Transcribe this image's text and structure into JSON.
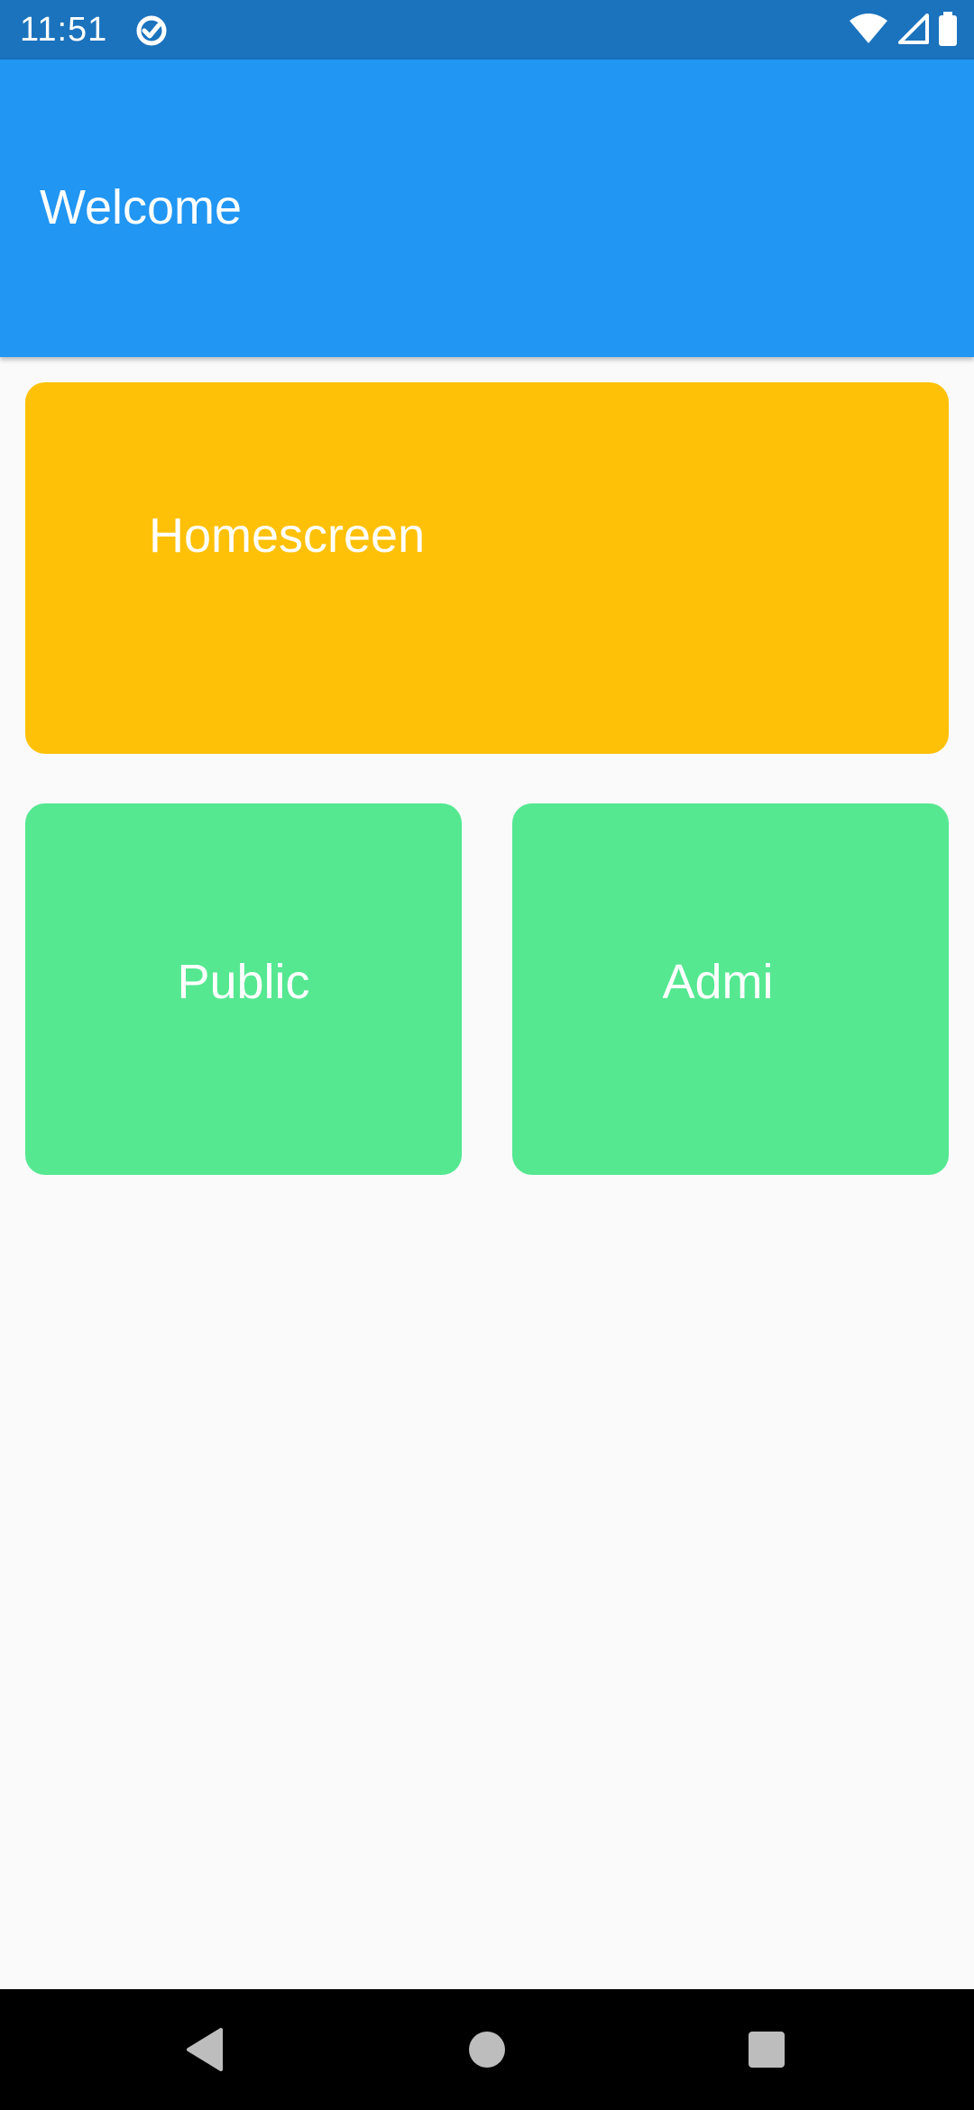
{
  "status_bar": {
    "time": "11:51",
    "app_icon": "data-saver-icon",
    "icons": [
      "wifi-icon",
      "cell-signal-icon",
      "battery-icon"
    ],
    "background": "#1b72bd"
  },
  "app_bar": {
    "title": "Welcome",
    "background": "#2196f3"
  },
  "tiles": [
    {
      "label": "Homescreen",
      "color": "#ffc107"
    },
    {
      "label": "Public",
      "color": "#55e891"
    },
    {
      "label": "Admi",
      "color": "#55e891"
    }
  ],
  "nav_bar": {
    "buttons": [
      "back-icon",
      "home-icon",
      "recents-icon"
    ]
  }
}
